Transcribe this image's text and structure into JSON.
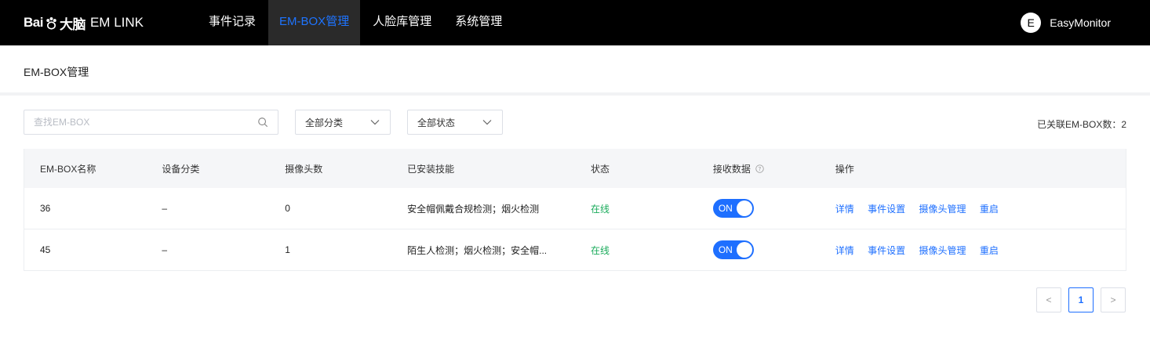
{
  "brand": {
    "logo_text": "Bai",
    "logo_cn": "大脑",
    "product": "EM LINK"
  },
  "nav": {
    "items": [
      {
        "label": "事件记录"
      },
      {
        "label": "EM-BOX管理"
      },
      {
        "label": "人脸库管理"
      },
      {
        "label": "系统管理"
      }
    ],
    "active_index": 1
  },
  "user": {
    "initial": "E",
    "name": "EasyMonitor"
  },
  "page": {
    "title": "EM-BOX管理"
  },
  "toolbar": {
    "search_placeholder": "查找EM-BOX",
    "category_filter": "全部分类",
    "status_filter": "全部状态",
    "count_label": "已关联EM-BOX数：2"
  },
  "table": {
    "columns": [
      "EM-BOX名称",
      "设备分类",
      "摄像头数",
      "已安装技能",
      "状态",
      "接收数据",
      "操作"
    ],
    "rows": [
      {
        "name": "36",
        "category": "–",
        "cameras": "0",
        "skills": "安全帽佩戴合规检测；烟火检测",
        "status": "在线",
        "receive": "ON"
      },
      {
        "name": "45",
        "category": "–",
        "cameras": "1",
        "skills": "陌生人检测；烟火检测；安全帽...",
        "status": "在线",
        "receive": "ON"
      }
    ],
    "actions": [
      "详情",
      "事件设置",
      "摄像头管理",
      "重启"
    ]
  },
  "pagination": {
    "prev": "<",
    "current": "1",
    "next": ">"
  },
  "colors": {
    "accent": "#1e6fff",
    "online": "#1aab5b",
    "topbar": "#000000"
  }
}
